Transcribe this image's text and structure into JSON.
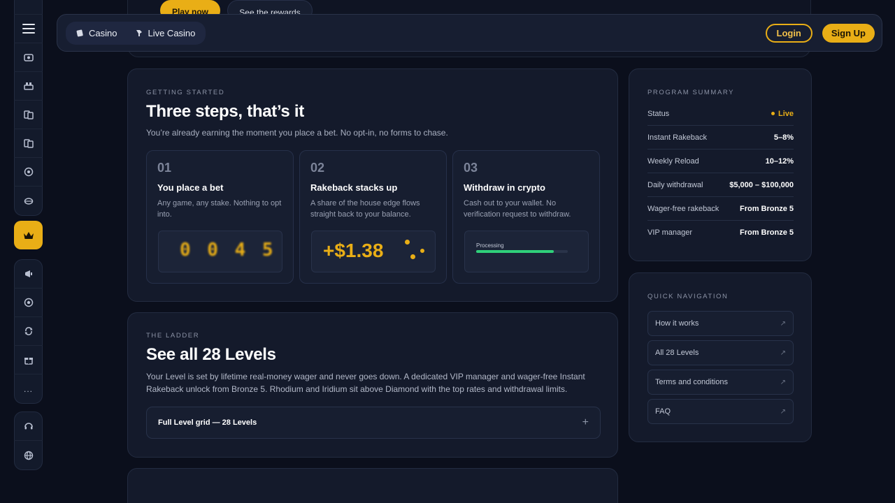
{
  "hero": {
    "play_label": "Play now",
    "rewards_label": "See the rewards"
  },
  "topbar": {
    "tabs": [
      {
        "label": "Casino",
        "icon": "casino-icon"
      },
      {
        "label": "Live Casino",
        "icon": "live-casino-icon"
      }
    ],
    "login_label": "Login",
    "signup_label": "Sign Up"
  },
  "steps_section": {
    "eyebrow": "GETTING STARTED",
    "title": "Three steps, that’s it",
    "subtitle": "You’re already earning the moment you place a bet. No opt-in, no forms to chase.",
    "steps": [
      {
        "num": "01",
        "title": "You place a bet",
        "desc": "Any game, any stake. Nothing to opt into.",
        "visual": "0 0 4 5"
      },
      {
        "num": "02",
        "title": "Rakeback stacks up",
        "desc": "A share of the house edge flows straight back to your balance.",
        "visual": "+$1.38"
      },
      {
        "num": "03",
        "title": "Withdraw in crypto",
        "desc": "Cash out to your wallet. No verification request to withdraw.",
        "visual": "Processing",
        "progress": 0.85
      }
    ]
  },
  "ladder_section": {
    "eyebrow": "THE LADDER",
    "title": "See all 28 Levels",
    "description": "Your Level is set by lifetime real-money wager and never goes down. A dedicated VIP manager and wager-free Instant Rakeback unlock from Bronze 5. Rhodium and Iridium sit above Diamond with the top rates and withdrawal limits.",
    "accordion_label": "Full Level grid — 28 Levels",
    "accordion_icon": "+"
  },
  "summary": {
    "eyebrow": "PROGRAM SUMMARY",
    "rows": [
      {
        "key": "Status",
        "value": "Live"
      },
      {
        "key": "Instant Rakeback",
        "value": "5–8%"
      },
      {
        "key": "Weekly Reload",
        "value": "10–12%"
      },
      {
        "key": "Daily withdrawal",
        "value": "$5,000 – $100,000"
      },
      {
        "key": "Wager-free rakeback",
        "value": "From Bronze 5"
      },
      {
        "key": "VIP manager",
        "value": "From Bronze 5"
      }
    ]
  },
  "quick_nav": {
    "eyebrow": "QUICK NAVIGATION",
    "items": [
      {
        "label": "How it works"
      },
      {
        "label": "All 28 Levels"
      },
      {
        "label": "Terms and conditions"
      },
      {
        "label": "FAQ"
      }
    ],
    "arrow": "↗"
  },
  "sidebar": {
    "more_label": "..."
  },
  "colors": {
    "accent": "#e9ae16",
    "background": "#0b0f1c",
    "card": "#141a2b",
    "progress": "#2fd07a"
  }
}
